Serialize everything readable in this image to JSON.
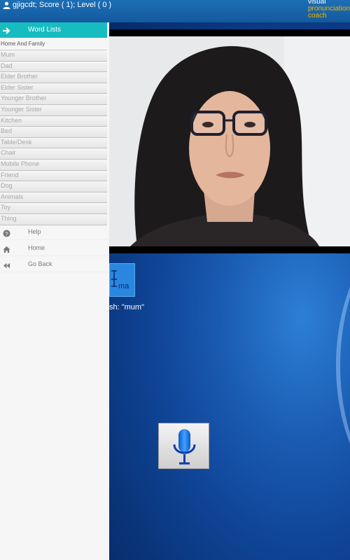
{
  "header": {
    "status": "gjigcdt; Score ( 1); Level ( 0 )",
    "brand": [
      "visual",
      "pronunciation",
      "coach"
    ]
  },
  "sidebar": {
    "header_label": "Word Lists",
    "category": "Home And Family",
    "words": [
      "Mum",
      "Dad",
      "Elder Brother",
      "Elder Sister",
      "Younger Brother",
      "Younger Sister",
      "Kitchen",
      "Bed",
      "Table/Desk",
      "Chair",
      "Mobile Phone",
      "Friend",
      "Dog",
      "Animals",
      "Toy",
      "Thing"
    ],
    "menu": [
      {
        "label": "Help",
        "icon": "question-circle-icon"
      },
      {
        "label": "Home",
        "icon": "home-icon"
      },
      {
        "label": "Go Back",
        "icon": "rewind-icon"
      }
    ]
  },
  "main": {
    "tile_text": "ma",
    "prompt": "sh: \"mum\"",
    "mic_icon": "microphone-icon"
  },
  "colors": {
    "accent": "#17bcc0",
    "topbar": "#1667ad",
    "brand_highlight": "#f2b400",
    "tile": "#2a87e0"
  }
}
